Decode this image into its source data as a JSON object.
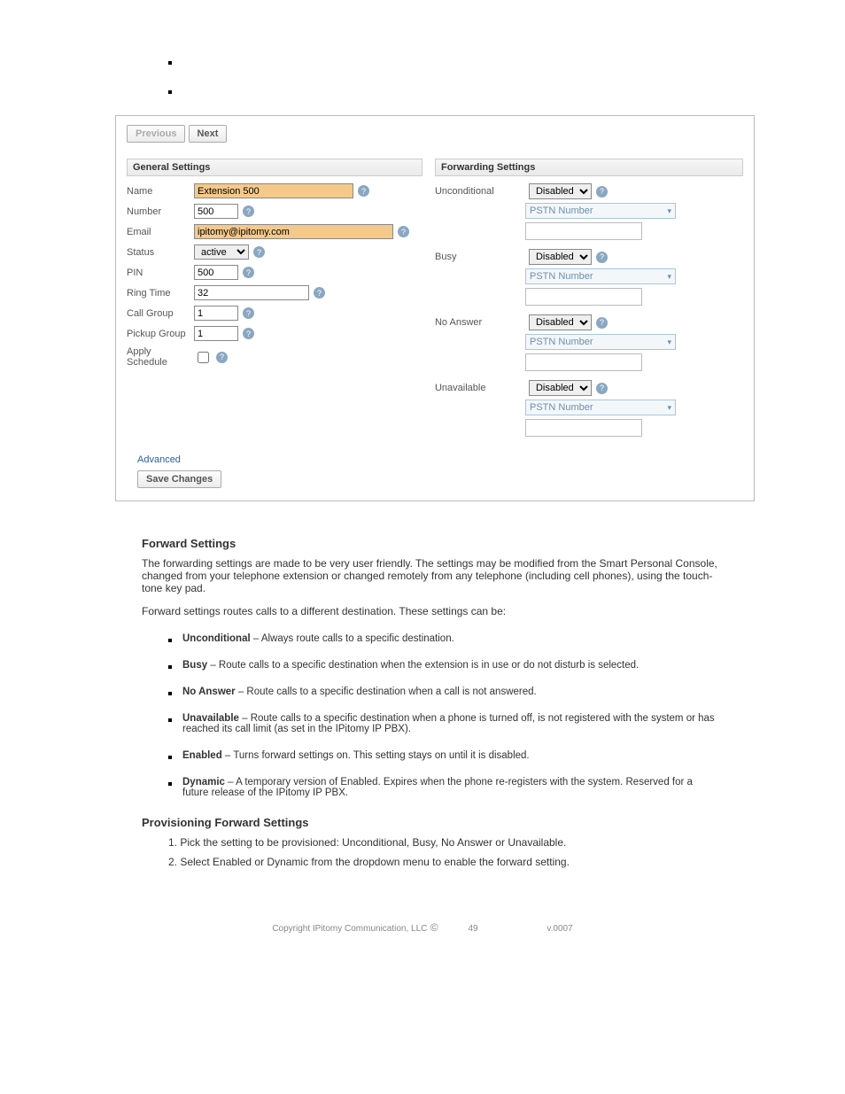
{
  "top_placeholder_a": " ",
  "top_placeholder_b": " ",
  "nav": {
    "previous": "Previous",
    "next": "Next"
  },
  "general": {
    "title": "General Settings",
    "labels": {
      "name": "Name",
      "number": "Number",
      "email": "Email",
      "status": "Status",
      "pin": "PIN",
      "ring_time": "Ring Time",
      "call_group": "Call Group",
      "pickup_group": "Pickup Group",
      "apply_schedule": "Apply Schedule"
    },
    "values": {
      "name": "Extension 500",
      "number": "500",
      "email": "ipitomy@ipitomy.com",
      "status": "active",
      "pin": "500",
      "ring_time": "32",
      "call_group": "1",
      "pickup_group": "1"
    }
  },
  "forwarding": {
    "title": "Forwarding Settings",
    "option_disabled": "Disabled",
    "pstn_label": "PSTN Number",
    "rows": {
      "unconditional": {
        "label": "Unconditional",
        "value": "Disabled"
      },
      "busy": {
        "label": "Busy",
        "value": "Disabled"
      },
      "no_answer": {
        "label": "No Answer",
        "value": "Disabled"
      },
      "unavailable": {
        "label": "Unavailable",
        "value": "Disabled"
      }
    }
  },
  "links": {
    "advanced": "Advanced",
    "save": "Save Changes"
  },
  "body": {
    "fs_heading": "Forward Settings",
    "fs_intro": "The forwarding settings are made to be very user friendly. The settings may be modified from the Smart Personal Console, changed from your telephone extension or changed remotely from any telephone (including cell phones), using the touch-tone key pad.",
    "fs_lead": "Forward settings routes calls to a different destination. These settings can be:",
    "items": {
      "uncond": {
        "b": "Unconditional",
        "t": " – Always route calls to a specific destination."
      },
      "busy": {
        "b": "Busy",
        "t": " – Route calls to a specific destination when the extension is in use or do not disturb is selected."
      },
      "no_ans": {
        "b": "No Answer",
        "t": " – Route calls to a specific destination when a call is not answered."
      },
      "unavail": {
        "b": "Unavailable",
        "t": " – Route calls to a specific destination when a phone is turned off, is not registered with the system or has reached its call limit (as set in the IPitomy IP PBX)."
      },
      "enabled": {
        "b": "Enabled",
        "t": " – Turns forward settings on. This setting stays on until it is disabled."
      },
      "dyn": {
        "b": "Dynamic",
        "t": " – A temporary version of Enabled. Expires when the phone re-registers with the system. Reserved for a future release of the IPitomy IP PBX."
      }
    },
    "prov_heading": "Provisioning Forward Settings",
    "prov_steps_a": "1. Pick the setting to be provisioned: Unconditional, Busy, No Answer or Unavailable.",
    "prov_steps_b": "2. Select Enabled or Dynamic from the dropdown menu to enable the forward setting."
  },
  "footer": {
    "copyright": "Copyright   IPitomy Communication, LLC",
    "page": "49",
    "ver": "v.0007"
  }
}
